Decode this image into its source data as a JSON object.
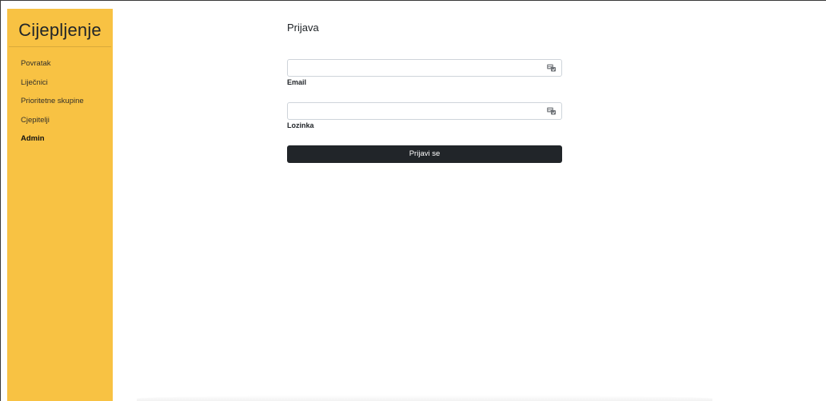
{
  "sidebar": {
    "brand": "Cijepljenje",
    "items": [
      {
        "label": "Povratak",
        "active": false
      },
      {
        "label": "Liječnici",
        "active": false
      },
      {
        "label": "Prioritetne skupine",
        "active": false
      },
      {
        "label": "Cjepitelji",
        "active": false
      },
      {
        "label": "Admin",
        "active": true
      }
    ]
  },
  "login": {
    "title": "Prijava",
    "email": {
      "label": "Email",
      "value": "",
      "placeholder": ""
    },
    "password": {
      "label": "Lozinka",
      "value": "",
      "placeholder": ""
    },
    "submit_label": "Prijavi se",
    "autofill_icon": "key-autofill-icon"
  },
  "colors": {
    "sidebar_bg": "#f8c243",
    "button_bg": "#212529",
    "button_text": "#ffffff",
    "input_border": "#ced4da"
  }
}
